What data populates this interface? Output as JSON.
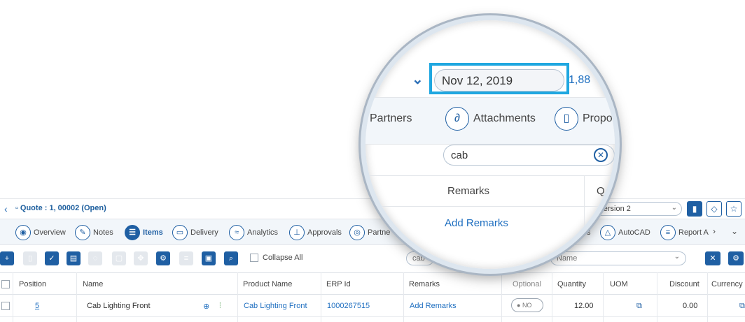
{
  "header": {
    "back_icon": "chevron-left-icon",
    "quote_icon": "document-icon",
    "quote_title": "Quote : 1, 00002 (Open)",
    "version": "Version 2",
    "buttons": [
      "chart-icon",
      "tag-icon",
      "star-icon"
    ]
  },
  "tabs": [
    {
      "label": "Overview",
      "icon": "cube-icon"
    },
    {
      "label": "Notes",
      "icon": "edit-icon"
    },
    {
      "label": "Items",
      "icon": "list-icon",
      "active": true
    },
    {
      "label": "Delivery",
      "icon": "truck-icon"
    },
    {
      "label": "Analytics",
      "icon": "wave-icon"
    },
    {
      "label": "Approvals",
      "icon": "stamp-icon"
    },
    {
      "label": "Partne",
      "icon": "user-icon"
    },
    {
      "label": "s",
      "icon": ""
    },
    {
      "label": "AutoCAD",
      "icon": "triangle-icon"
    },
    {
      "label": "Report A",
      "icon": "report-icon"
    }
  ],
  "toolbar": {
    "collapse_all": "Collapse All",
    "search_value": "cab",
    "name_placeholder": "Name"
  },
  "table": {
    "columns": [
      "Position",
      "Name",
      "Product Name",
      "ERP Id",
      "Remarks",
      "Optional",
      "Quantity",
      "UOM",
      "Discount",
      "Currency"
    ],
    "rows": [
      {
        "position": "5",
        "name": "Cab Lighting Front",
        "product_name": "Cab Lighting Front",
        "erp_id": "1000267515",
        "remarks": "Add Remarks",
        "optional": "NO",
        "quantity": "12.00",
        "discount": "0.00"
      }
    ]
  },
  "magnifier": {
    "date": "Nov 12, 2019",
    "amount_fragment": "1,88",
    "tabs": [
      "Partners",
      "Attachments",
      "Propo"
    ],
    "search_value": "cab",
    "column_remarks": "Remarks",
    "column_fragment": "Q",
    "add_remarks": "Add Remarks",
    "highlight_color": "#1fa7e0"
  }
}
